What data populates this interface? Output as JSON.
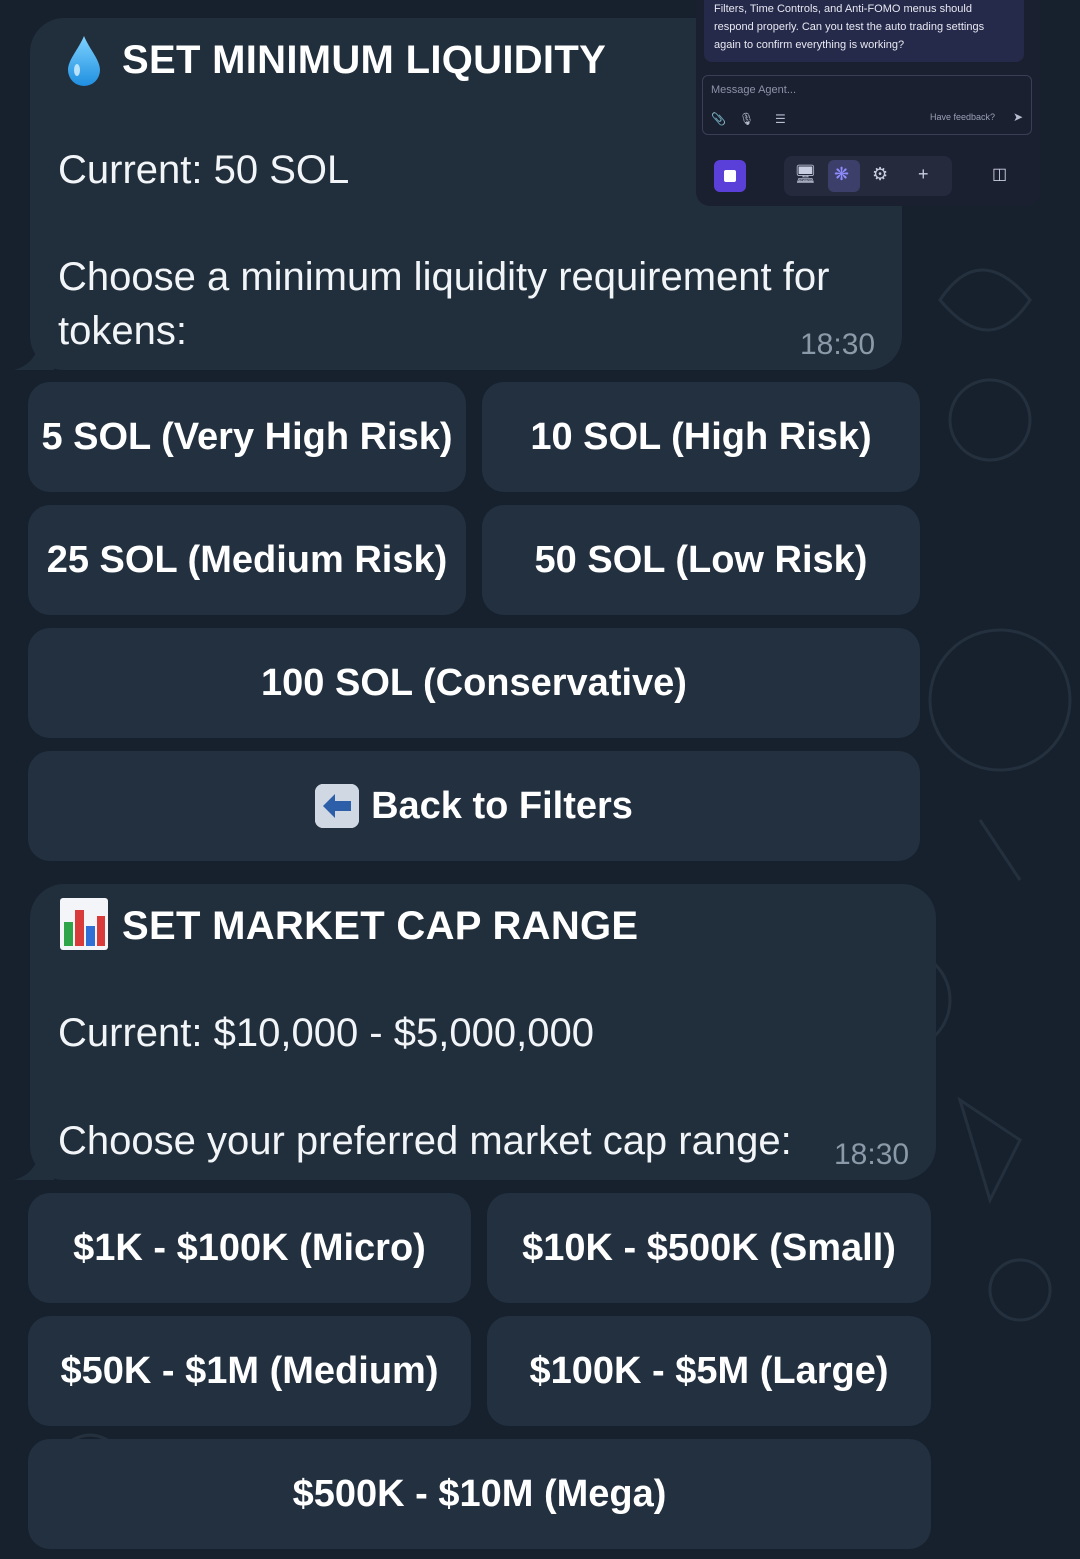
{
  "liquidity_message": {
    "icon": "droplet-icon",
    "title": "SET MINIMUM LIQUIDITY",
    "current": "Current: 50 SOL",
    "prompt_line1": "Choose a minimum liquidity requirement for",
    "prompt_line2": "tokens:",
    "time": "18:30"
  },
  "liquidity_buttons": [
    "5 SOL (Very High Risk)",
    "10 SOL (High Risk)",
    "25 SOL (Medium Risk)",
    "50 SOL (Low Risk)",
    "100 SOL (Conservative)"
  ],
  "back_button": {
    "icon": "back-arrow-icon",
    "label": "Back to Filters"
  },
  "marketcap_message": {
    "icon": "bar-chart-icon",
    "title": "SET MARKET CAP RANGE",
    "current": "Current: $10,000 - $5,000,000",
    "prompt": "Choose your preferred market cap range:",
    "time": "18:30"
  },
  "marketcap_buttons": [
    "$1K - $100K (Micro)",
    "$10K - $500K (Small)",
    "$50K - $1M (Medium)",
    "$100K - $5M (Large)",
    "$500K - $10M (Mega)"
  ],
  "agent_panel": {
    "message_line1": "Filters, Time Controls, and Anti-FOMO menus should",
    "message_line2": "respond properly. Can you test the auto trading settings",
    "message_line3": "again to confirm everything is working?",
    "input_placeholder": "Message Agent...",
    "feedback_label": "Have feedback?"
  },
  "colors": {
    "background": "#16212d",
    "bubble": "#212e3b",
    "button": "#223040",
    "agent_accent": "#5b3fd9"
  }
}
